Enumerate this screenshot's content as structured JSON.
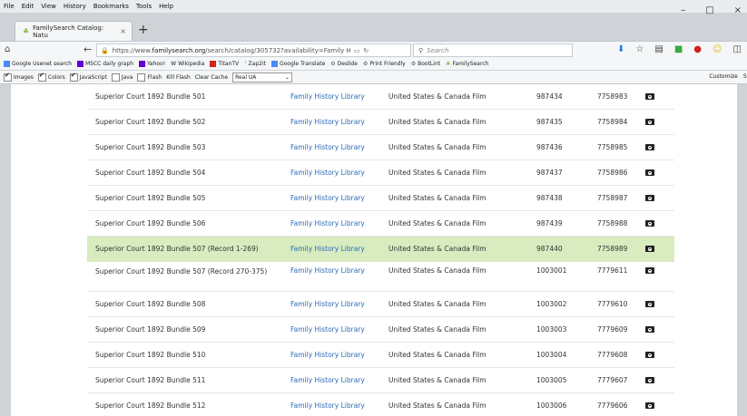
{
  "menu": [
    "File",
    "Edit",
    "View",
    "History",
    "Bookmarks",
    "Tools",
    "Help"
  ],
  "window_controls": [
    "–",
    "□",
    "×"
  ],
  "tab": {
    "title": "FamilySearch Catalog: Natu",
    "close": "×",
    "new_tab": "+"
  },
  "nav": {
    "url_prefix": "https://www.",
    "url_domain": "familysearch.org",
    "url_path": "/search/catalog/305732?availability=Family History Libr",
    "search_placeholder": "Search"
  },
  "bookmarks": [
    "Google Usenet search",
    "MSCC daily graph",
    "Yahoo!",
    "Wikipedia",
    "TitanTV",
    "Zap2it",
    "Google Translate",
    "Deslide",
    "Print Friendly",
    "BootLint",
    "FamilySearch"
  ],
  "extbar": {
    "images": "Images",
    "colors": "Colors",
    "javascript": "JavaScript",
    "java": "Java",
    "flash": "Flash",
    "kill_flash": "Kill Flash",
    "clear_cache": "Clear Cache",
    "ua": "Real UA",
    "customize": "Customize",
    "st": "St"
  },
  "rows": [
    {
      "title": "Superior Court 1892 Bundle 501",
      "library": "Family History Library",
      "collection": "United States & Canada Film",
      "film": "987434",
      "item": "7758983"
    },
    {
      "title": "Superior Court 1892 Bundle 502",
      "library": "Family History Library",
      "collection": "United States & Canada Film",
      "film": "987435",
      "item": "7758984"
    },
    {
      "title": "Superior Court 1892 Bundle 503",
      "library": "Family History Library",
      "collection": "United States & Canada Film",
      "film": "987436",
      "item": "7758985"
    },
    {
      "title": "Superior Court 1892 Bundle 504",
      "library": "Family History Library",
      "collection": "United States & Canada Film",
      "film": "987437",
      "item": "7758986"
    },
    {
      "title": "Superior Court 1892 Bundle 505",
      "library": "Family History Library",
      "collection": "United States & Canada Film",
      "film": "987438",
      "item": "7758987"
    },
    {
      "title": "Superior Court 1892 Bundle 506",
      "library": "Family History Library",
      "collection": "United States & Canada Film",
      "film": "987439",
      "item": "7758988"
    },
    {
      "title": "Superior Court 1892 Bundle 507 (Record 1-269)",
      "library": "Family History Library",
      "collection": "United States & Canada Film",
      "film": "987440",
      "item": "7758989"
    },
    {
      "title": "Superior Court 1892 Bundle 507 (Record 270-375)",
      "library": "Family History Library",
      "collection": "United States & Canada Film",
      "film": "1003001",
      "item": "7779611"
    },
    {
      "title": "Superior Court 1892 Bundle 508",
      "library": "Family History Library",
      "collection": "United States & Canada Film",
      "film": "1003002",
      "item": "7779610"
    },
    {
      "title": "Superior Court 1892 Bundle 509",
      "library": "Family History Library",
      "collection": "United States & Canada Film",
      "film": "1003003",
      "item": "7779609"
    },
    {
      "title": "Superior Court 1892 Bundle 510",
      "library": "Family History Library",
      "collection": "United States & Canada Film",
      "film": "1003004",
      "item": "7779608"
    },
    {
      "title": "Superior Court 1892 Bundle 511",
      "library": "Family History Library",
      "collection": "United States & Canada Film",
      "film": "1003005",
      "item": "7779607"
    },
    {
      "title": "Superior Court 1892 Bundle 512",
      "library": "Family History Library",
      "collection": "United States & Canada Film",
      "film": "1003006",
      "item": "7779606"
    }
  ],
  "highlight_color": "#d8ecc0",
  "link_color": "#2b6ab7"
}
